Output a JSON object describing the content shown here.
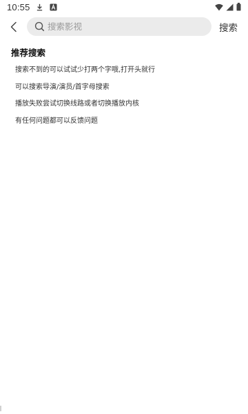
{
  "status_bar": {
    "time": "10:55",
    "left_icons": [
      "download-icon",
      "app-a-icon"
    ],
    "right_icons": [
      "wifi-icon",
      "signal-icon",
      "battery-icon"
    ]
  },
  "header": {
    "back_icon": "chevron-left-icon",
    "search_placeholder": "搜索影视",
    "search_value": "",
    "search_button_label": "搜索"
  },
  "recommendations": {
    "title": "推荐搜索",
    "items": [
      "搜索不到的可以试试少打两个字哦,打开头就行",
      "可以搜索导演/演员/首字母搜索",
      "播放失败尝试切换线路或者切换播放内核",
      "有任何问题都可以反馈问题"
    ]
  },
  "colors": {
    "background": "#ffffff",
    "search_box": "#ebebeb",
    "text_primary": "#111111",
    "text_secondary": "#333333",
    "placeholder": "#9a9a9a"
  }
}
